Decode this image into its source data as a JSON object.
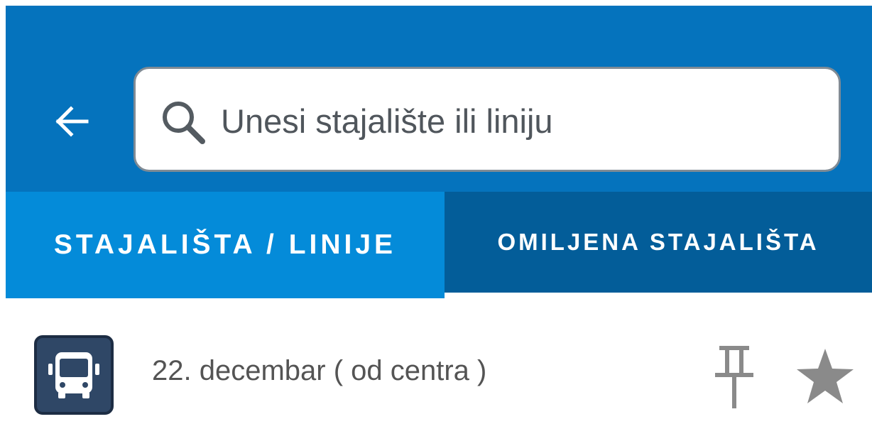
{
  "header": {
    "back_icon": "arrow-left-icon",
    "search": {
      "icon": "search-icon",
      "placeholder": "Unesi stajalište ili liniju",
      "value": ""
    }
  },
  "tabs": [
    {
      "label": "STAJALIŠTA / LINIJE",
      "active": true
    },
    {
      "label": "OMILJENA STAJALIŠTA",
      "active": false
    }
  ],
  "stops": [
    {
      "icon": "bus-icon",
      "name": "22. decembar ( od centra )",
      "pin_icon": "pin-icon",
      "favorite_icon": "star-icon"
    }
  ],
  "colors": {
    "header_bg": "#0573bd",
    "tab_active_bg": "#048bd9",
    "tab_inactive_bg": "#035d99",
    "bus_badge_bg": "#2f4766",
    "icon_gray": "#8a8a8a"
  }
}
